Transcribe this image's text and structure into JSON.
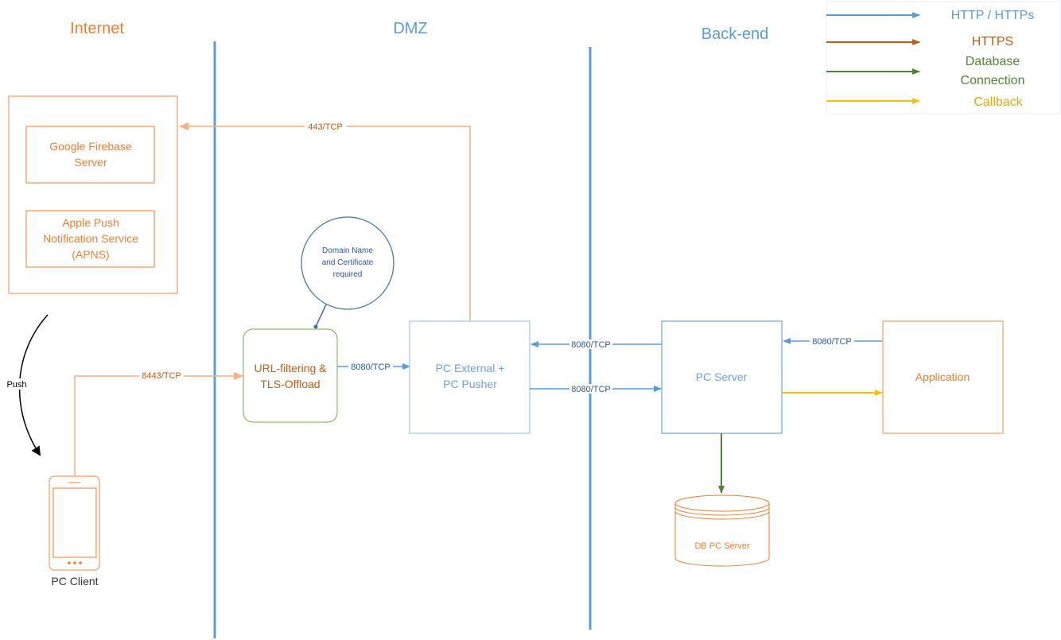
{
  "colors": {
    "http_blue": "#5b9bd5",
    "https_orange": "#c55a11",
    "link_orange": "#f4b183",
    "box_orange": "#ed7d31",
    "db_green": "#538135",
    "callback_yellow": "#ffc000",
    "zone_divider": "#5b9bd5",
    "tls_box_green": "#70ad47",
    "box_blue_border": "#9dc3e6",
    "text_blue": "#6fa0d8"
  },
  "zones": {
    "internet": "Internet",
    "dmz": "DMZ",
    "backend": "Back-end"
  },
  "legend": [
    {
      "label_lines": [
        "HTTP / HTTPs"
      ],
      "type": "http"
    },
    {
      "label_lines": [
        "HTTPS"
      ],
      "type": "https"
    },
    {
      "label_lines": [
        "Database",
        "Connection"
      ],
      "type": "database"
    },
    {
      "label_lines": [
        "Callback"
      ],
      "type": "callback"
    }
  ],
  "nodes": {
    "firebase": [
      "Google Firebase",
      "Server"
    ],
    "apns": [
      "Apple Push",
      "Notification Service",
      "(APNS)"
    ],
    "callout": [
      "Domain Name",
      "and Certificate",
      "required"
    ],
    "tls": [
      "URL-filtering &",
      "TLS-Offload"
    ],
    "external": [
      "PC External +",
      "PC Pusher"
    ],
    "server": [
      "PC Server"
    ],
    "application": [
      "Application"
    ],
    "db": [
      "DB PC Server"
    ],
    "client": [
      "PC Client"
    ]
  },
  "edges": {
    "push": "Push",
    "external_to_push_services": "443/TCP",
    "client_to_tls": "8443/TCP",
    "tls_to_external": "8080/TCP",
    "server_to_external": "8080/TCP",
    "external_to_server": "8080/TCP",
    "application_to_server": "8080/TCP"
  }
}
